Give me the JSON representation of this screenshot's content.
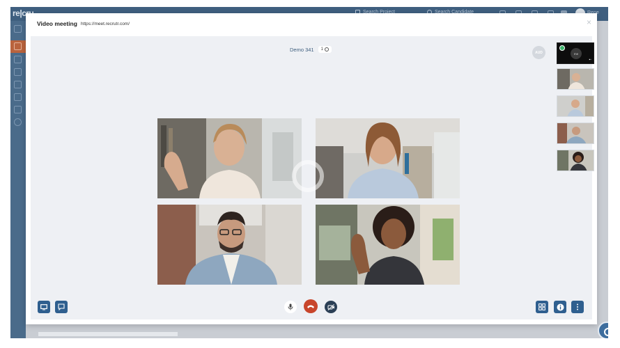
{
  "app": {
    "logo": "re|cru",
    "top_nav": {
      "search_project": "Search Project",
      "search_candidate": "Search Candidate",
      "user_name": "Rene"
    }
  },
  "modal": {
    "title": "Video meeting",
    "url": "https://meet.recrutr.com/",
    "close": "×"
  },
  "room": {
    "name": "Demo 341",
    "participant_count": "1"
  },
  "aud_badge": "AUD",
  "self_thumb": {
    "avatar_text": "me"
  },
  "colors": {
    "brand_blue": "#2f5f8f",
    "end_call_red": "#c8452b",
    "stage_bg": "#eef0f4"
  },
  "controls": {
    "left": [
      {
        "name": "screen-share-button",
        "icon": "monitor-icon"
      },
      {
        "name": "chat-button",
        "icon": "chat-icon"
      }
    ],
    "center": [
      {
        "name": "mic-button",
        "icon": "microphone-icon"
      },
      {
        "name": "end-call-button",
        "icon": "phone-hangup-icon"
      },
      {
        "name": "camera-off-button",
        "icon": "camera-off-icon"
      }
    ],
    "right": [
      {
        "name": "grid-view-button",
        "icon": "grid-icon"
      },
      {
        "name": "info-button",
        "icon": "info-icon"
      },
      {
        "name": "more-button",
        "icon": "more-vertical-icon"
      }
    ]
  }
}
